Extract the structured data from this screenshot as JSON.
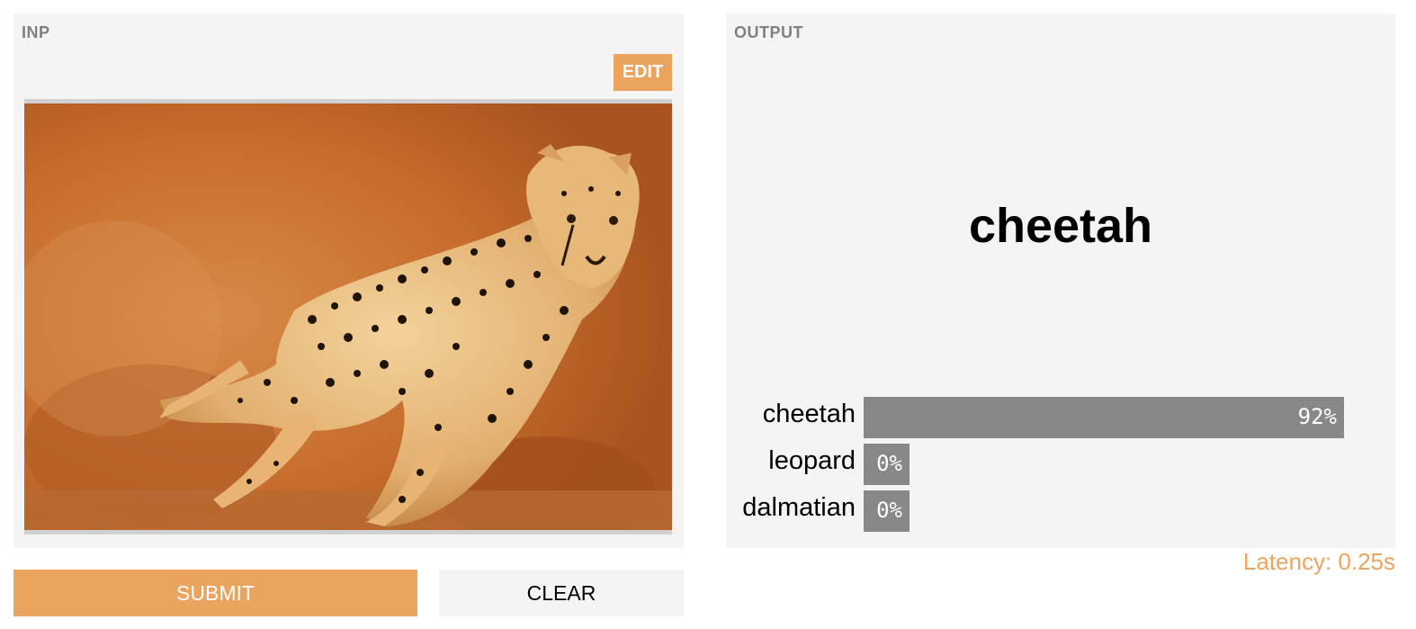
{
  "input": {
    "label": "INP",
    "edit_label": "EDIT"
  },
  "output": {
    "label": "OUTPUT",
    "predicted": "cheetah",
    "confidences": [
      {
        "label": "cheetah",
        "value": 0.92,
        "display": "92%"
      },
      {
        "label": "leopard",
        "value": 0.0,
        "display": "0%"
      },
      {
        "label": "dalmatian",
        "value": 0.0,
        "display": "0%"
      }
    ],
    "latency": "Latency: 0.25s"
  },
  "actions": {
    "submit_label": "SUBMIT",
    "clear_label": "CLEAR"
  },
  "colors": {
    "accent": "#eba45e",
    "bar": "#888888",
    "panel": "#f4f4f4"
  }
}
